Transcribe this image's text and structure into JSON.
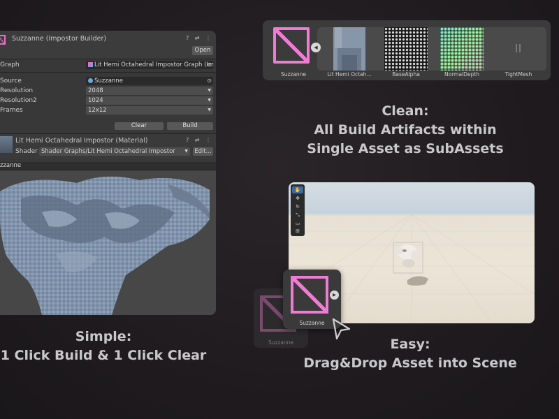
{
  "inspector": {
    "title": "Suzzanne (Impostor Builder)",
    "header_icons": "? ⇄ ⋮",
    "open_label": "Open",
    "graph_label": "Graph",
    "graph_value": "Lit Hemi Octahedral Impostor Graph (Imp",
    "source_label": "Source",
    "source_value": "Suzzanne",
    "resolution_label": "Resolution",
    "resolution_value": "2048",
    "resolution2_label": "Resolution2",
    "resolution2_value": "1024",
    "frames_label": "Frames",
    "frames_value": "12x12",
    "clear_label": "Clear",
    "build_label": "Build"
  },
  "material": {
    "title": "Lit Hemi Octahedral Impostor (Material)",
    "header_icons": "? ⇄ ⋮",
    "shader_label": "Shader",
    "shader_value": "Shader Graphs/Lit Hemi Octahedral Impostor",
    "edit_label": "Edit..."
  },
  "preview": {
    "header": "zzanne"
  },
  "asset_strip": {
    "items": [
      {
        "label": "Suzzanne"
      },
      {
        "label": "Lit Hemi Octah..."
      },
      {
        "label": "BaseAlpha"
      },
      {
        "label": "NormalDepth"
      },
      {
        "label": "TightMesh"
      }
    ]
  },
  "captions": {
    "clean_line1": "Clean:",
    "clean_line2": "All Build Artifacts within",
    "clean_line3": "Single Asset as SubAssets",
    "simple_line1": "Simple:",
    "simple_line2": "1 Click Build & 1 Click Clear",
    "easy_line1": "Easy:",
    "easy_line2": "Drag&Drop Asset into Scene"
  },
  "drag": {
    "asset_label": "Suzzanne",
    "ghost_label": "Suzzanne"
  },
  "colors": {
    "accent_pink": "#f07ad4",
    "panel_bg": "#383838",
    "background": "#1f1b1f"
  }
}
